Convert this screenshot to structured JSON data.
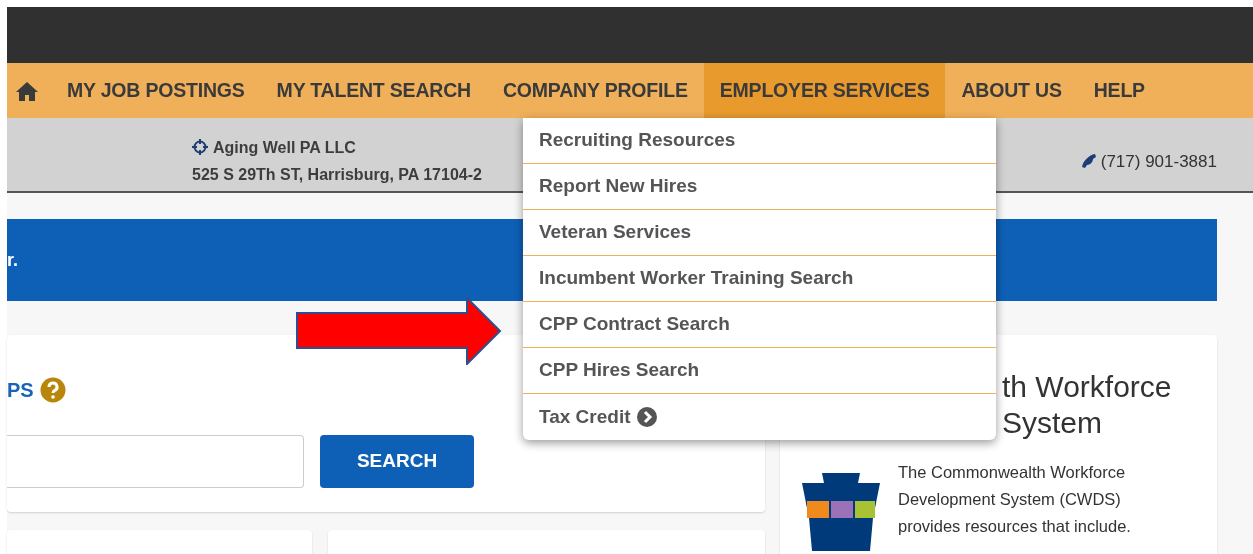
{
  "nav": {
    "items": [
      {
        "label": "MY JOB POSTINGS",
        "selected": false
      },
      {
        "label": "MY TALENT SEARCH",
        "selected": false
      },
      {
        "label": "COMPANY PROFILE",
        "selected": false
      },
      {
        "label": "EMPLOYER SERVICES",
        "selected": true
      },
      {
        "label": "ABOUT US",
        "selected": false
      },
      {
        "label": "HELP",
        "selected": false
      }
    ]
  },
  "employer": {
    "name": "Aging Well PA LLC",
    "address": "525 S 29Th ST, Harrisburg, PA 17104-2",
    "phone": "(717) 901-3881"
  },
  "banner": {
    "text": "r."
  },
  "search_card": {
    "heading": "PS",
    "button": "SEARCH"
  },
  "info_card": {
    "title_lines": [
      "th Workforce",
      "System"
    ],
    "text": "The Commonwealth Workforce Development System (CWDS) provides resources that include."
  },
  "dropdown": {
    "items": [
      {
        "label": "Recruiting Resources",
        "kind": "link"
      },
      {
        "label": "Report New Hires",
        "kind": "link"
      },
      {
        "label": "Veteran Services",
        "kind": "link"
      },
      {
        "label": "Incumbent Worker Training Search",
        "kind": "link"
      },
      {
        "label": "CPP Contract Search",
        "kind": "link"
      },
      {
        "label": "CPP Hires Search",
        "kind": "link"
      },
      {
        "label": "Tax Credit",
        "kind": "submenu"
      }
    ]
  }
}
